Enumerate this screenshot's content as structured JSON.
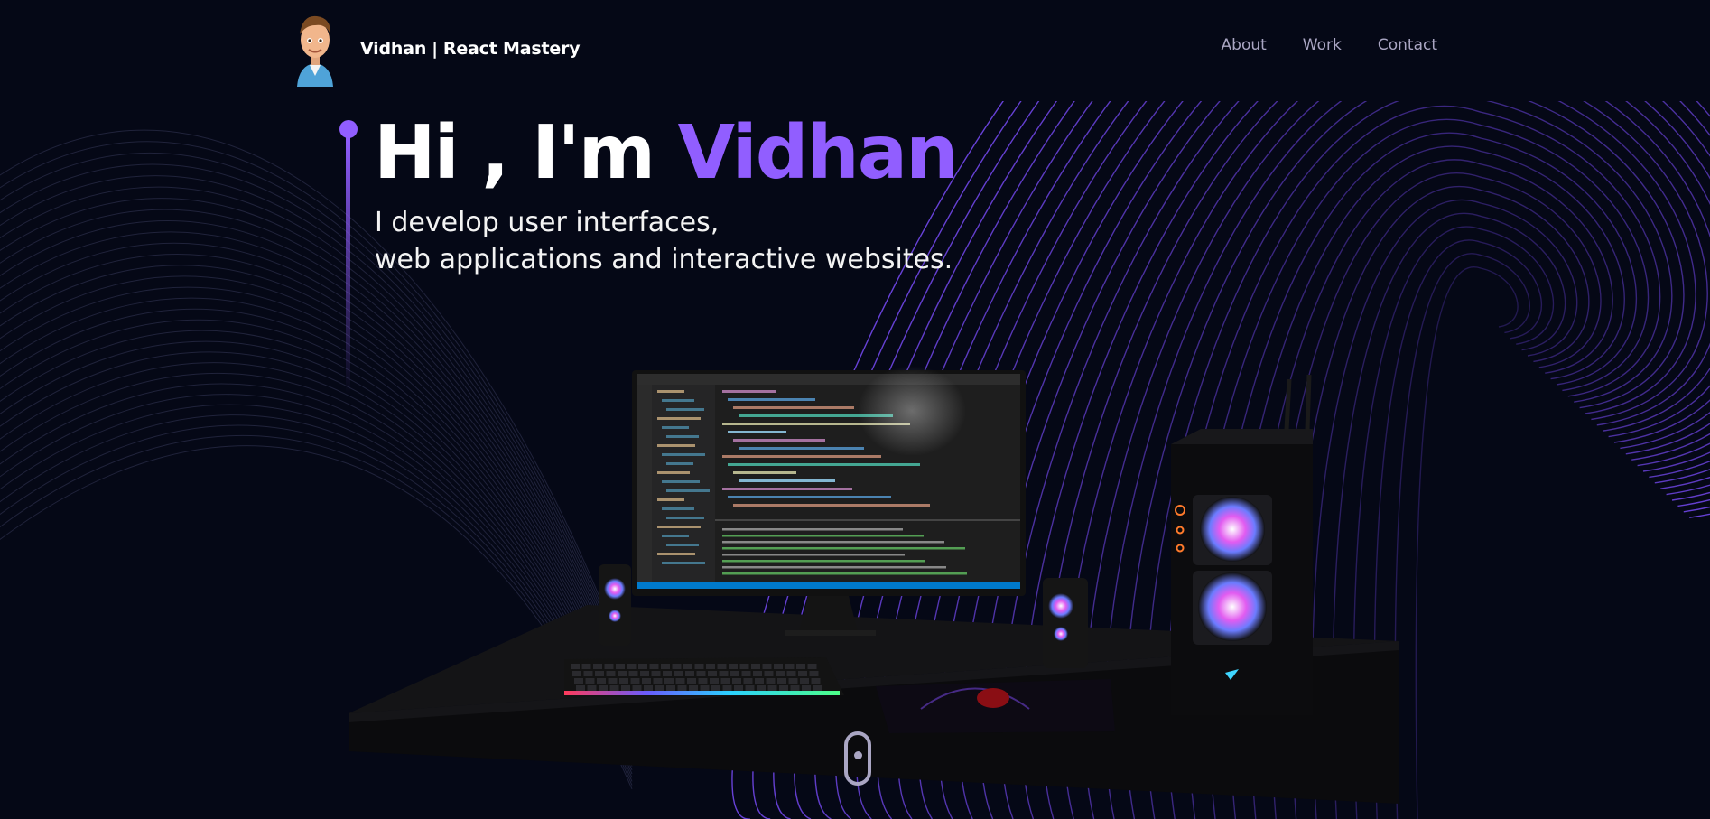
{
  "nav": {
    "brand_name": "Vidhan",
    "brand_separator": "|",
    "brand_tagline": "React Mastery",
    "links": [
      {
        "label": "About"
      },
      {
        "label": "Work"
      },
      {
        "label": "Contact"
      }
    ]
  },
  "hero": {
    "greeting": "Hi , I'm ",
    "name": "Vidhan",
    "subtitle_line1": "I develop user interfaces,",
    "subtitle_line2": "web applications and interactive websites."
  },
  "colors": {
    "background": "#050816",
    "accent": "#915eff",
    "nav_link": "#aaa6c3",
    "text": "#ffffff"
  },
  "icons": {
    "logo": "cartoon-avatar-icon",
    "scroll": "mouse-scroll-icon"
  }
}
